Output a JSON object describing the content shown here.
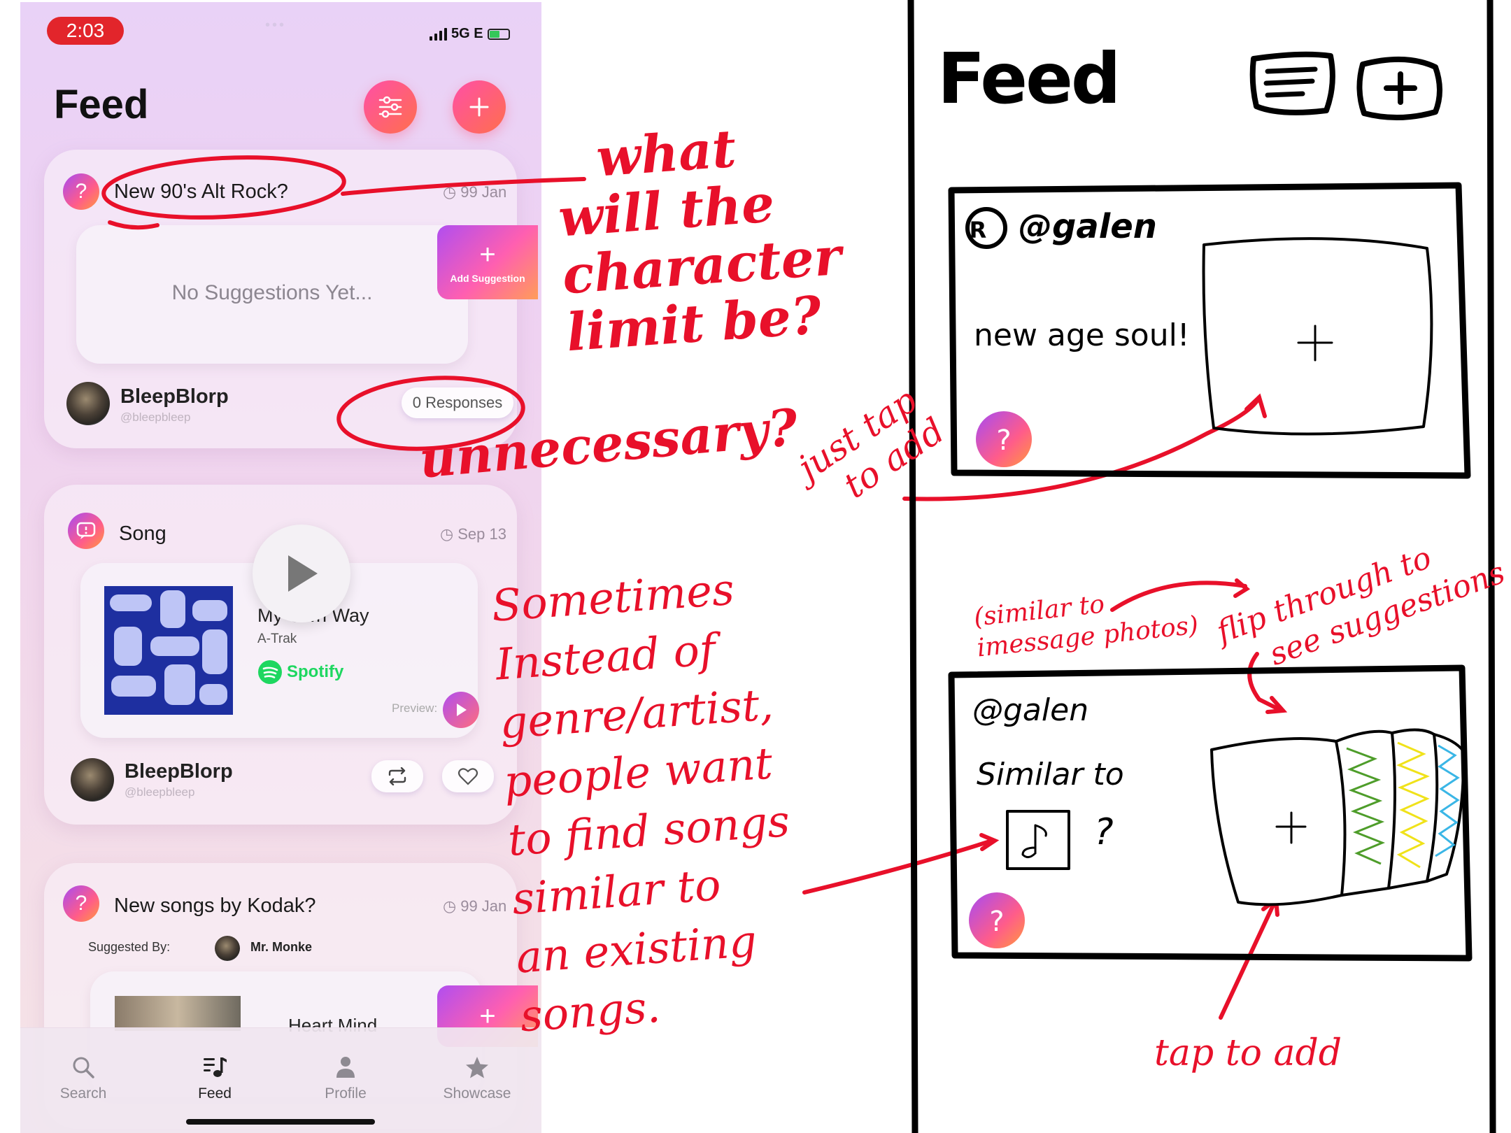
{
  "phone": {
    "status": {
      "time": "2:03",
      "network": "5G E"
    },
    "title": "Feed",
    "header_buttons": {
      "filter_icon": "sliders-icon",
      "add_icon": "plus-icon"
    },
    "posts": [
      {
        "kind": "question",
        "title": "New 90's Alt Rock?",
        "time": "99 Jan",
        "empty_text": "No Suggestions Yet...",
        "add_label": "Add Suggestion",
        "user": {
          "name": "BleepBlorp",
          "handle": "@bleepbleep"
        },
        "responses": "0 Responses"
      },
      {
        "kind": "song",
        "title": "Song",
        "time": "Sep 13",
        "track": {
          "name": "My Own Way",
          "artist": "A-Trak",
          "service": "Spotify",
          "preview_label": "Preview:"
        },
        "user": {
          "name": "BleepBlorp",
          "handle": "@bleepbleep"
        }
      },
      {
        "kind": "question",
        "title": "New songs by Kodak?",
        "time": "99 Jan",
        "suggested_by_label": "Suggested By:",
        "suggested_by_name": "Mr. Monke",
        "suggestion_track": "Heart Mind"
      }
    ],
    "tabs": [
      {
        "label": "Search",
        "icon": "search-icon",
        "active": false
      },
      {
        "label": "Feed",
        "icon": "music-list-icon",
        "active": true
      },
      {
        "label": "Profile",
        "icon": "person-icon",
        "active": false
      },
      {
        "label": "Showcase",
        "icon": "star-icon",
        "active": false
      }
    ],
    "colors": {
      "accent_gradient_start": "#a64bf4",
      "accent_gradient_end": "#ff9a3c",
      "status_red": "#e2252b"
    }
  },
  "annotations": {
    "character_limit": [
      "what",
      "will the",
      "character",
      "limit be?"
    ],
    "unnecessary": "unnecessary?",
    "sometimes": [
      "Sometimes",
      "Instead of",
      "genre/artist,",
      "people want",
      "to find songs",
      "similar to",
      "an existing",
      "songs."
    ],
    "just_tap": [
      "just tap",
      "to add"
    ],
    "similar_imessage": [
      "(similar to",
      "imessage photos)"
    ],
    "flip_through": [
      "flip through to",
      "see suggestions"
    ],
    "tap_to_add": "tap to add",
    "color": "#e8102a"
  },
  "sketch": {
    "title": "Feed",
    "card1": {
      "user": "@galen",
      "text": "new age soul!"
    },
    "card2": {
      "user": "@galen",
      "text": "Similar to",
      "question_mark": "?"
    }
  }
}
